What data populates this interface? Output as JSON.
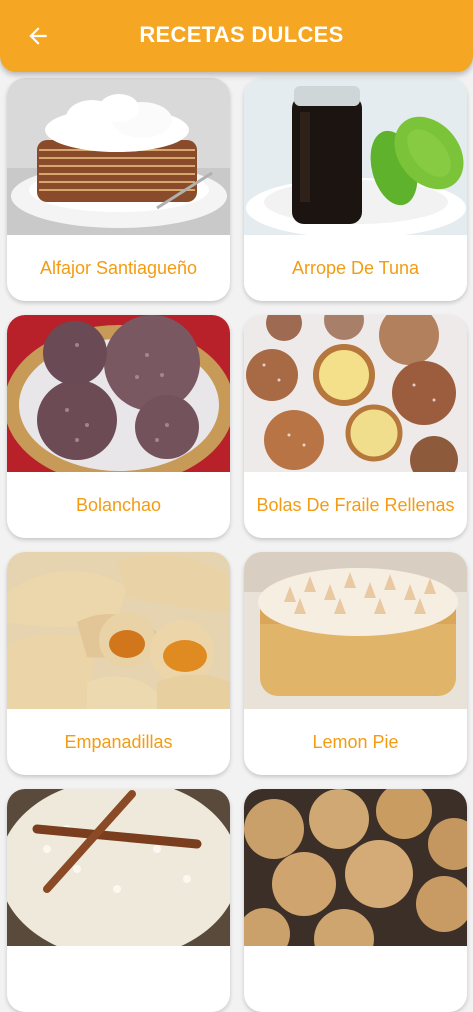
{
  "header": {
    "title": "RECETAS DULCES",
    "back_icon": "arrow-left-icon",
    "color": "#f5a623"
  },
  "accent_text_color": "#f39c12",
  "recipes": [
    {
      "label": "Alfajor Santiagueño",
      "image": "layered-cake-with-meringue"
    },
    {
      "label": "Arrope De Tuna",
      "image": "jar-of-syrup-with-prickly-pears"
    },
    {
      "label": "Bolanchao",
      "image": "basket-of-round-sweets"
    },
    {
      "label": "Bolas De Fraile Rellenas",
      "image": "sugared-filled-donuts"
    },
    {
      "label": "Empanadillas",
      "image": "sweet-empanadas-with-filling"
    },
    {
      "label": "Lemon Pie",
      "image": "lemon-meringue-pie"
    },
    {
      "label": "",
      "image": "rice-pudding-with-cinnamon"
    },
    {
      "label": "",
      "image": "tray-of-cookies"
    }
  ]
}
